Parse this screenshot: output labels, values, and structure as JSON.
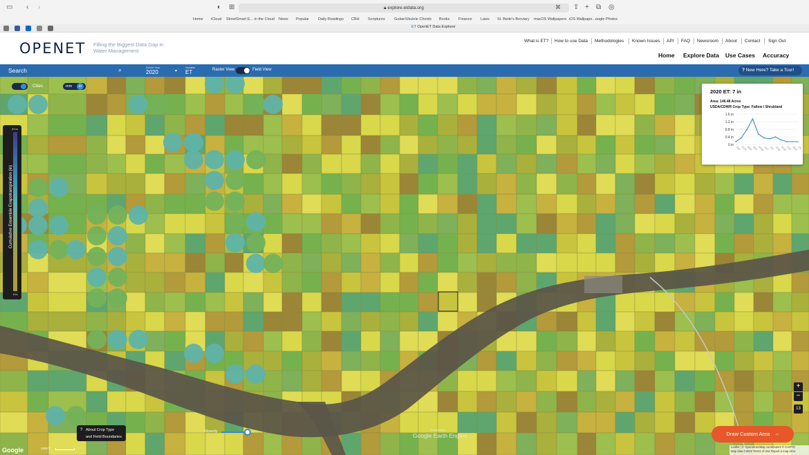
{
  "browser": {
    "url": "explore.etdata.org",
    "tab_title": "OpenET Data Explorer",
    "favorites": [
      "Home",
      "iCloud",
      "StreetSmart E... in the Cloud",
      "News",
      "Popular",
      "Daily Readings",
      "CBH",
      "Scriptures",
      "Guitar/Ukulele Chords",
      "Books",
      "Finance",
      "Laws",
      "St. Bede's Breviary",
      "macOS Wallpapers",
      "iOS Wallpape...oogle Photos"
    ]
  },
  "site": {
    "logo": "OPENET",
    "tagline": "Filling the Biggest Data Gap in Water Management",
    "top_links": [
      "What is ET?",
      "How to use Data",
      "Methodologies",
      "Known Issues",
      "API",
      "FAQ",
      "Newsroom",
      "About",
      "Contact",
      "Sign Out"
    ],
    "main_nav": [
      "Home",
      "Explore Data",
      "Use Cases",
      "Accuracy"
    ]
  },
  "controls": {
    "search_label": "Search",
    "year_label": "Select Year",
    "year_value": "2020",
    "variable_label": "Variable",
    "variable_value": "ET",
    "raster_label": "Raster View",
    "field_label": "Field View",
    "tour_label": "New Here? Take a Tour!"
  },
  "map": {
    "cities_label": "Cities",
    "unit_mm": "mm",
    "unit_in": "in",
    "legend_max": "47 in",
    "legend_min": "0 in",
    "legend_title": "Cumulative Ensemble Evapotranspiration (in)",
    "about_crop_line1": "About Crop Type",
    "about_crop_line2": "and Field Boundaries",
    "opacity_label": "Opacity",
    "powered_by": "Powered by",
    "gee_label": "Google Earth Engine",
    "draw_label": "Draw Custom Area",
    "zoom_level": "13",
    "scale_label": "2000 ft",
    "google_label": "Google",
    "attribution": "Leaflet | © OpenStreetMap contributors © CARTO",
    "attribution2": "Map data ©2022   Terms of Use   Report a map error"
  },
  "popup": {
    "title": "2020 ET: 7 in",
    "area": "Area: 146.48 Acres",
    "crop": "USDA/CDWR Crop Type: Fallow / Shrubland"
  },
  "chart_data": {
    "type": "line",
    "categories": [
      "Jan",
      "Feb",
      "Mar",
      "Apr",
      "May",
      "Jun",
      "Jul",
      "Aug",
      "Sep",
      "Oct",
      "Nov",
      "Dec"
    ],
    "values": [
      0.15,
      0.35,
      0.8,
      1.35,
      0.55,
      0.35,
      0.3,
      0.4,
      0.25,
      0.15,
      0.15,
      0.15
    ],
    "ytick_labels": [
      "1.6 in",
      "1.2 in",
      "0.8 in",
      "0.4 in",
      "0 in"
    ],
    "ylim": [
      0,
      1.6
    ],
    "color": "#3b87d4"
  },
  "colors": {
    "nav_blue": "#2b6cb0",
    "draw_button": "#e8572a",
    "logo_navy": "#0f1f4a"
  }
}
